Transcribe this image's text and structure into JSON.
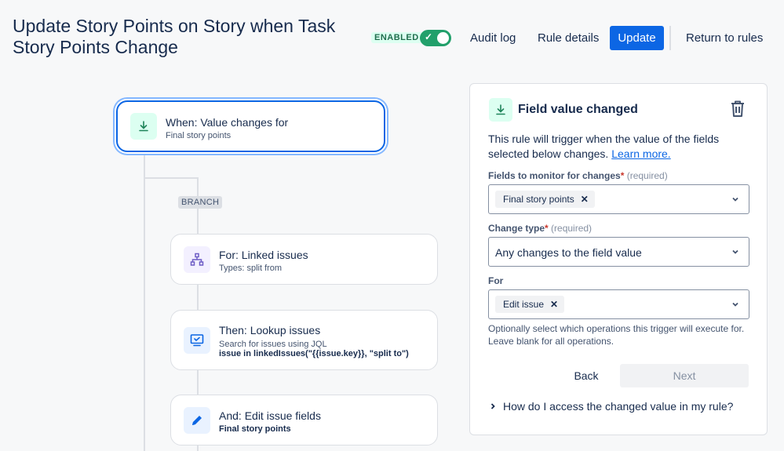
{
  "header": {
    "title": "Update Story Points on Story when Task Story Points Change",
    "enabled_label": "ENABLED",
    "audit_log": "Audit log",
    "rule_details": "Rule details",
    "update": "Update",
    "return_to_rules": "Return to rules"
  },
  "flow": {
    "trigger": {
      "title": "When: Value changes for",
      "subtitle": "Final story points"
    },
    "branch_label": "BRANCH",
    "steps": [
      {
        "title": "For: Linked issues",
        "subtitle": "Types: split from"
      },
      {
        "title": "Then: Lookup issues",
        "subtitle": "Search for issues using JQL",
        "detail": "issue in linkedIssues(\"{{issue.key}}, \"split to\")"
      },
      {
        "title": "And: Edit issue fields",
        "detail": "Final story points"
      }
    ]
  },
  "panel": {
    "title": "Field value changed",
    "description": "This rule will trigger when the value of the fields selected below changes.",
    "learn_more": "Learn more.",
    "fields_label": "Fields to monitor for changes",
    "required_text": "(required)",
    "fields_chip": "Final story points",
    "change_type_label": "Change type",
    "change_type_value": "Any changes to the field value",
    "for_label": "For",
    "for_chip": "Edit issue",
    "help_text": "Optionally select which operations this trigger will execute for. Leave blank for all operations.",
    "back": "Back",
    "next": "Next",
    "howto": "How do I access the changed value in my rule?"
  },
  "colors": {
    "primary": "#0c66e4",
    "enabled": "#22a06b",
    "trigger_icon_bg": "#dcfff1",
    "branch_icon_bg": "#f3f0ff",
    "action_icon_bg": "#e9f2ff"
  },
  "icons": {
    "trigger": "download-arrow-icon",
    "branch": "hierarchy-icon",
    "lookup": "monitor-icon",
    "edit": "pencil-icon",
    "delete": "trash-icon"
  }
}
